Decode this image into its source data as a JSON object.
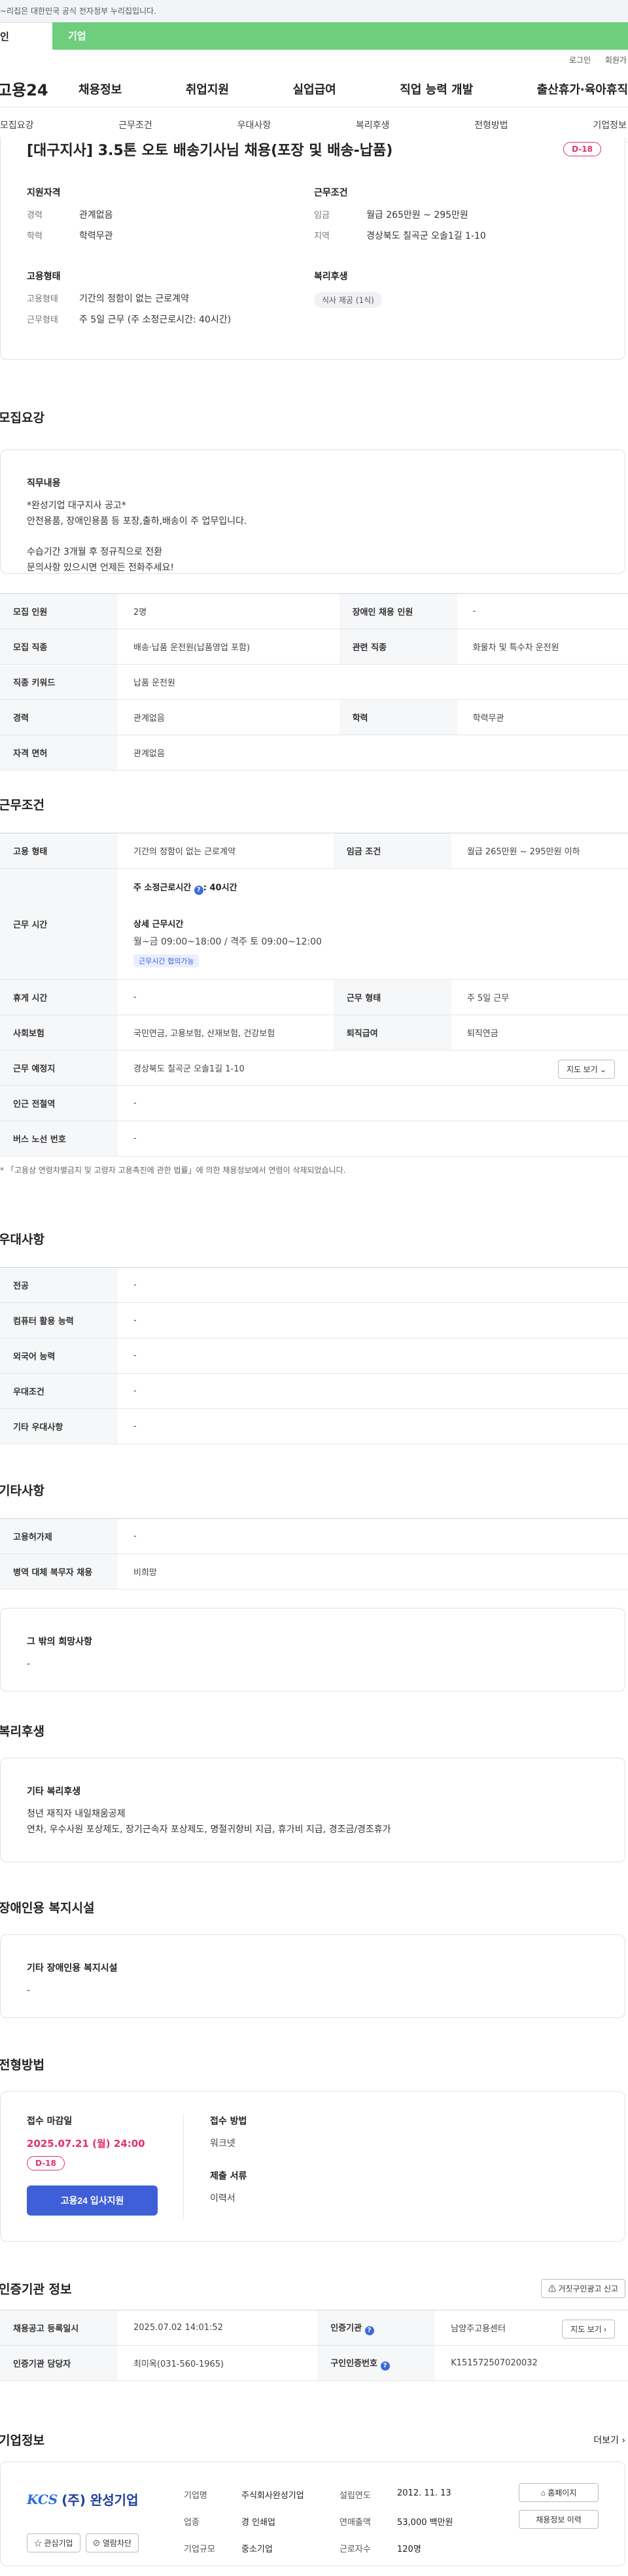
{
  "banner": {
    "text": "~리집은 대한민국 공식 전자정부 누리집입니다."
  },
  "top_tabs": {
    "personal": "인",
    "business": "기업"
  },
  "util": {
    "login": "로그인",
    "join": "회원가"
  },
  "gnb": {
    "logo": "고용24",
    "menu": [
      "채용정보",
      "취업지원",
      "실업급여",
      "직업 능력 개발",
      "출산휴가·육아휴직"
    ]
  },
  "subnav": [
    "모집요강",
    "근무조건",
    "우대사항",
    "복리후생",
    "전형방법",
    "기업정보"
  ],
  "summary": {
    "title": "[대구지사] 3.5톤 오토 배송기사님 채용(포장 및 배송-납품)",
    "dday": "D-18",
    "qualification": {
      "heading": "지원자격",
      "career_k": "경력",
      "career_v": "관계없음",
      "edu_k": "학력",
      "edu_v": "학력무관"
    },
    "conditions": {
      "heading": "근무조건",
      "wage_k": "임금",
      "wage_v": "월급 265만원 ~ 295만원",
      "region_k": "지역",
      "region_v": "경상북도 칠곡군 오솔1길 1-10"
    },
    "employment": {
      "heading": "고용형태",
      "type_k": "고용형태",
      "type_v": "기간의 정함이 없는 근로계약",
      "shape_k": "근무형태",
      "shape_v": "주 5일 근무 (주 소정근로시간: 40시간)"
    },
    "welfare": {
      "heading": "복리후생",
      "chip": "식사 제공 (1식)"
    }
  },
  "recruit": {
    "title": "모집요강",
    "duty_heading": "직무내용",
    "duty_text": "*완성기업 대구지사 공고*\n안전용품, 장애인용품 등 포장,출하,배송이 주 업무입니다.\n\n수습기간 3개월 후 정규직으로 전환\n문의사항 있으시면 언제든 전화주세요!",
    "rows": [
      [
        "모집 인원",
        "2명",
        "장애인 채용 인원",
        "-"
      ],
      [
        "모집 직종",
        "배송·납품 운전원(납품영업 포함)",
        "관련 직종",
        "화물차 및 특수차 운전원"
      ],
      [
        "직종 키워드",
        "납품 운전원",
        "",
        ""
      ],
      [
        "경력",
        "관계없음",
        "학력",
        "학력무관"
      ],
      [
        "자격 면허",
        "관계없음",
        "",
        ""
      ]
    ]
  },
  "work": {
    "title": "근무조건",
    "type_k": "고용 형태",
    "type_v": "기간의 정함이 없는 근로계약",
    "wage_k": "임금 조건",
    "wage_v": "월급 265만원 ~ 295만원 이하",
    "hours_k": "근무 시간",
    "weekly": "주 소정근로시간",
    "weekly_v": ": 40시간",
    "q": "?",
    "detail_label": "상세 근무시간",
    "detail_v": "월~금 09:00~18:00 / 격주 토 09:00~12:00",
    "negotiable": "근무시간 협의가능",
    "break_k": "휴게 시간",
    "break_v": "-",
    "shape_k": "근무 형태",
    "shape_v": "주 5일 근무",
    "insurance_k": "사회보험",
    "insurance_v": "국민연금, 고용보험, 산재보험, 건강보험",
    "severance_k": "퇴직급여",
    "severance_v": "퇴직연금",
    "place_k": "근무 예정지",
    "place_v": "경상북도 칠곡군 오솔1길 1-10",
    "map_btn": "지도 보기",
    "subway_k": "인근 전철역",
    "subway_v": "-",
    "bus_k": "버스 노선 번호",
    "bus_v": "-",
    "note": "* 「고용상 연령차별금지 및 고령자 고용촉진에 관한 법률」에 의한 채용정보에서 연령이 삭제되었습니다."
  },
  "pref": {
    "title": "우대사항",
    "rows": [
      [
        "전공",
        "-"
      ],
      [
        "컴퓨터 활용 능력",
        "-"
      ],
      [
        "외국어 능력",
        "-"
      ],
      [
        "우대조건",
        "-"
      ],
      [
        "기타 우대사항",
        "-"
      ]
    ]
  },
  "etc": {
    "title": "기타사항",
    "rows": [
      [
        "고용허가제",
        "-"
      ],
      [
        "병역 대체 복무자 채용",
        "비희망"
      ]
    ],
    "hope_heading": "그 밖의 희망사항",
    "hope_v": "-"
  },
  "welfare": {
    "title": "복리후생",
    "heading": "기타 복리후생",
    "text": "청년 재직자 내일채움공제\n연차, 우수사원 포상제도, 장기근속자 포상제도, 명절귀향비 지급, 휴가비 지급, 경조금/경조휴가"
  },
  "disability": {
    "title": "장애인용 복지시설",
    "heading": "기타 장애인용 복지시설",
    "v": "-"
  },
  "selection": {
    "title": "전형방법",
    "deadline_heading": "접수 마감일",
    "deadline": "2025.07.21 (월) 24:00",
    "dday": "D-18",
    "apply_btn": "고용24 입사지원",
    "method_heading": "접수 방법",
    "method_v": "워크넷",
    "docs_heading": "제출 서류",
    "docs_v": "이력서"
  },
  "cert": {
    "title": "인증기관 정보",
    "report_btn": "거짓구인광고 신고",
    "reg_k": "채용공고 등록일시",
    "reg_v": "2025.07.02 14:01:52",
    "agency_k": "인증기관",
    "agency_v": "남양주고용센터",
    "map_btn": "지도 보기",
    "manager_k": "인증기관 담당자",
    "manager_v": "최미옥(031-560-1965)",
    "num_k": "구인인증번호",
    "num_v": "K151572507020032"
  },
  "company": {
    "title": "기업정보",
    "more": "더보기",
    "logo_mark": "KCS",
    "name": "(주) 완성기업",
    "fav_btn": "관심기업",
    "block_btn": "열람차단",
    "name_k": "기업명",
    "name_v": "주식회사완성기업",
    "founded_k": "설립연도",
    "founded_v": "2012. 11. 13",
    "biz_k": "업종",
    "biz_v": "경 인쇄업",
    "sales_k": "연매출액",
    "sales_v": "53,000 백만원",
    "size_k": "기업규모",
    "size_v": "중소기업",
    "staff_k": "근로자수",
    "staff_v": "120명",
    "homepage_btn": "홈페이지",
    "history_btn": "채용정보 이력"
  }
}
